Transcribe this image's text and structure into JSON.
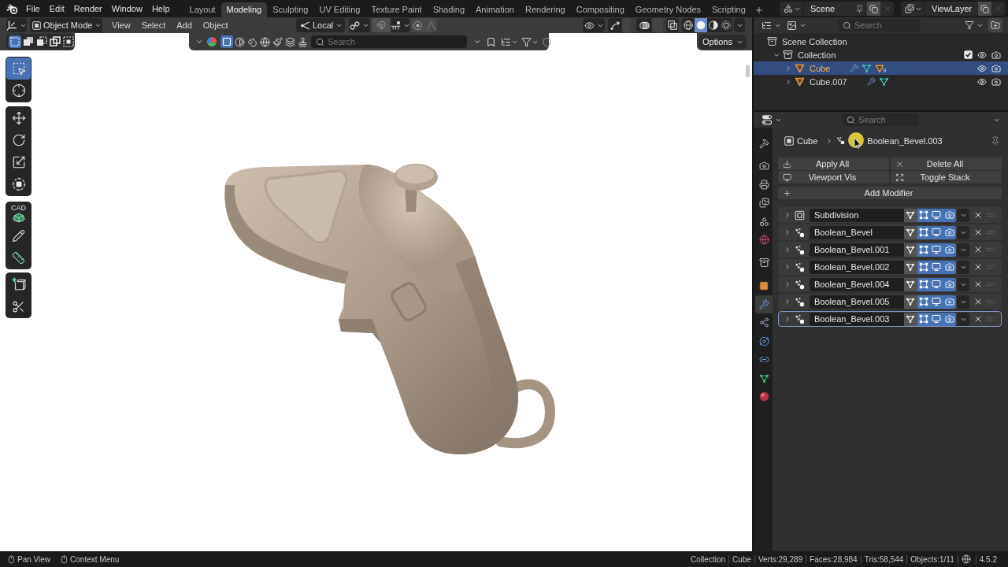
{
  "topbar": {
    "menus": [
      "File",
      "Edit",
      "Render",
      "Window",
      "Help"
    ],
    "workspaces": [
      {
        "label": "Layout",
        "selected": false
      },
      {
        "label": "Modeling",
        "selected": true
      },
      {
        "label": "Sculpting",
        "selected": false
      },
      {
        "label": "UV Editing",
        "selected": false
      },
      {
        "label": "Texture Paint",
        "selected": false
      },
      {
        "label": "Shading",
        "selected": false
      },
      {
        "label": "Animation",
        "selected": false
      },
      {
        "label": "Rendering",
        "selected": false
      },
      {
        "label": "Compositing",
        "selected": false
      },
      {
        "label": "Geometry Nodes",
        "selected": false
      },
      {
        "label": "Scripting",
        "selected": false
      }
    ],
    "scene": "Scene",
    "view_layer": "ViewLayer"
  },
  "viewport": {
    "header": {
      "mode": "Object Mode",
      "menus": [
        "View",
        "Select",
        "Add",
        "Object"
      ],
      "transform_orientation": "Local",
      "shading": [
        {
          "kind": "wireframe",
          "selected": false
        },
        {
          "kind": "solid",
          "selected": true
        },
        {
          "kind": "material",
          "selected": false
        },
        {
          "kind": "rendered",
          "selected": false
        }
      ]
    },
    "tool_header": {
      "select_modes": [
        {
          "kind": "set",
          "selected": true
        },
        {
          "kind": "extend",
          "selected": false
        },
        {
          "kind": "subtract",
          "selected": false
        },
        {
          "kind": "difference",
          "selected": false
        },
        {
          "kind": "intersect",
          "selected": false
        }
      ],
      "filters": [
        {
          "kind": "object",
          "selected": true
        },
        {
          "kind": "pie",
          "selected": false
        },
        {
          "kind": "drops",
          "selected": false
        },
        {
          "kind": "globe",
          "selected": false
        },
        {
          "kind": "brush",
          "selected": false
        },
        {
          "kind": "layers",
          "selected": false
        },
        {
          "kind": "stamp",
          "selected": false
        }
      ],
      "search": {
        "placeholder": "Search"
      },
      "options": "Options"
    },
    "toolbar": [
      {
        "tools": [
          {
            "kind": "select_box",
            "selected": true
          },
          {
            "kind": "cursor",
            "selected": false
          }
        ]
      },
      {
        "tools": [
          {
            "kind": "move",
            "selected": false
          },
          {
            "kind": "rotate",
            "selected": false
          },
          {
            "kind": "scale",
            "selected": false
          },
          {
            "kind": "transform",
            "selected": false
          }
        ]
      },
      {
        "tools": [
          {
            "kind": "cad",
            "label": "CAD",
            "selected": false
          },
          {
            "kind": "annotate",
            "selected": false
          },
          {
            "kind": "measure",
            "selected": false
          }
        ]
      },
      {
        "tools": [
          {
            "kind": "add_cube",
            "selected": false
          },
          {
            "kind": "cut",
            "selected": false
          }
        ]
      }
    ]
  },
  "outliner": {
    "search": {
      "placeholder": "Search"
    },
    "tree": [
      {
        "kind": "scene_collection",
        "label": "Scene Collection",
        "selected": false,
        "children": [
          {
            "kind": "collection",
            "label": "Collection",
            "selected": false,
            "expanded": true,
            "checked": true,
            "children": [
              {
                "kind": "object",
                "label": "Cube",
                "selected": true,
                "expanded": false,
                "children_count": "9"
              },
              {
                "kind": "object",
                "label": "Cube.007",
                "selected": false,
                "expanded": false
              }
            ]
          }
        ]
      }
    ]
  },
  "properties": {
    "search": {
      "placeholder": "Search"
    },
    "tab_groups": [
      {
        "tabs": [
          {
            "kind": "tool",
            "selected": false
          }
        ]
      },
      {
        "tabs": [
          {
            "kind": "render",
            "selected": false
          },
          {
            "kind": "output",
            "selected": false
          },
          {
            "kind": "view_layer",
            "selected": false
          },
          {
            "kind": "scene",
            "selected": false
          },
          {
            "kind": "world",
            "selected": false
          }
        ]
      },
      {
        "tabs": [
          {
            "kind": "collection",
            "selected": false
          }
        ]
      },
      {
        "tabs": [
          {
            "kind": "object",
            "selected": false
          },
          {
            "kind": "modifiers",
            "selected": true
          },
          {
            "kind": "particles",
            "selected": false
          },
          {
            "kind": "physics",
            "selected": false
          },
          {
            "kind": "constraints",
            "selected": false
          },
          {
            "kind": "data",
            "selected": false
          },
          {
            "kind": "material",
            "selected": false
          }
        ]
      }
    ],
    "breadcrumb": [
      {
        "kind": "object",
        "label": "Cube"
      },
      {
        "kind": "modifier",
        "label": "Boolean_Bevel.003"
      }
    ],
    "operators": [
      {
        "kind": "apply",
        "label": "Apply All"
      },
      {
        "kind": "delete",
        "label": "Delete All"
      },
      {
        "kind": "visibility",
        "label": "Viewport Vis"
      },
      {
        "kind": "toggle",
        "label": "Toggle Stack"
      }
    ],
    "add_modifier": "Add Modifier",
    "modifiers": [
      {
        "kind": "subdivision",
        "name": "Subdivision",
        "expanded": false,
        "selected": false,
        "on_cage": false,
        "edit_mode": true,
        "viewport": true,
        "render": true
      },
      {
        "kind": "boolean",
        "name": "Boolean_Bevel",
        "expanded": false,
        "selected": false,
        "on_cage": false,
        "edit_mode": true,
        "viewport": true,
        "render": true
      },
      {
        "kind": "boolean",
        "name": "Boolean_Bevel.001",
        "expanded": false,
        "selected": false,
        "on_cage": false,
        "edit_mode": true,
        "viewport": true,
        "render": true
      },
      {
        "kind": "boolean",
        "name": "Boolean_Bevel.002",
        "expanded": false,
        "selected": false,
        "on_cage": false,
        "edit_mode": true,
        "viewport": true,
        "render": true
      },
      {
        "kind": "boolean",
        "name": "Boolean_Bevel.004",
        "expanded": false,
        "selected": false,
        "on_cage": false,
        "edit_mode": true,
        "viewport": true,
        "render": true
      },
      {
        "kind": "boolean",
        "name": "Boolean_Bevel.005",
        "expanded": false,
        "selected": false,
        "on_cage": false,
        "edit_mode": true,
        "viewport": true,
        "render": true
      },
      {
        "kind": "boolean",
        "name": "Boolean_Bevel.003",
        "expanded": false,
        "selected": true,
        "on_cage": false,
        "edit_mode": true,
        "viewport": true,
        "render": true
      }
    ]
  },
  "status_bar": {
    "hints": [
      "Pan View",
      "Context Menu"
    ],
    "stats": [
      "Collection",
      "Cube",
      "Verts:29,289",
      "Faces:28,984",
      "Tris:58,544",
      "Objects:1/11"
    ],
    "version": "4.5.2"
  }
}
